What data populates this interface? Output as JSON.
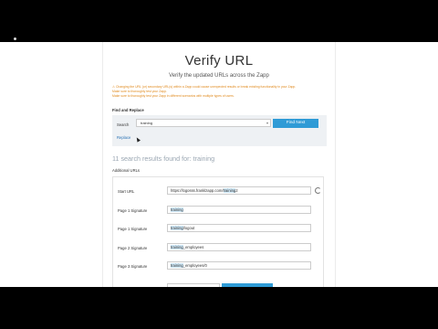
{
  "page": {
    "title": "Verify URL",
    "subtitle": "Verify the updated URLs across the Zapp",
    "warnings": [
      "⚠ Changing the URL (or) secondary URL(s) within a Zapp could cause unexpected results or break existing functionality in your Zapp.",
      "Make sure to thoroughly test your Zapp.",
      "Make sure to thoroughly test your Zapp in different scenarios with multiple types of users."
    ]
  },
  "find_replace": {
    "heading": "Find and Replace",
    "search_label": "Search",
    "search_value": "training",
    "find_next_label": "Find Next",
    "replace_link": "Replace"
  },
  "results": {
    "summary_prefix": "11 search results found for: ",
    "term": "training",
    "section_label": "Additional URLs"
  },
  "rows": [
    {
      "label": "Start URL",
      "value_prefix": "https://logosss.franklzapp.com/",
      "value_hl": "training",
      "value_suffix": "2"
    },
    {
      "label": "Page 1 Signature",
      "value_prefix": "",
      "value_hl": "training",
      "value_suffix": ""
    },
    {
      "label": "Page 1 Signature",
      "value_prefix": "",
      "value_hl": "training",
      "value_suffix": "/logout"
    },
    {
      "label": "Page 2 Signature",
      "value_prefix": "",
      "value_hl": "training",
      "value_suffix": "_employees"
    },
    {
      "label": "Page 3 Signature",
      "value_prefix": "",
      "value_hl": "training",
      "value_suffix": "_employees/0"
    }
  ],
  "icons": {
    "refresh": "refresh-icon",
    "dropdown": "chevron-down-icon",
    "cursor": "mouse-pointer-icon"
  },
  "colors": {
    "accent": "#2f9bd6",
    "warning": "#e08a1e",
    "highlight": "#cfe8f7"
  }
}
